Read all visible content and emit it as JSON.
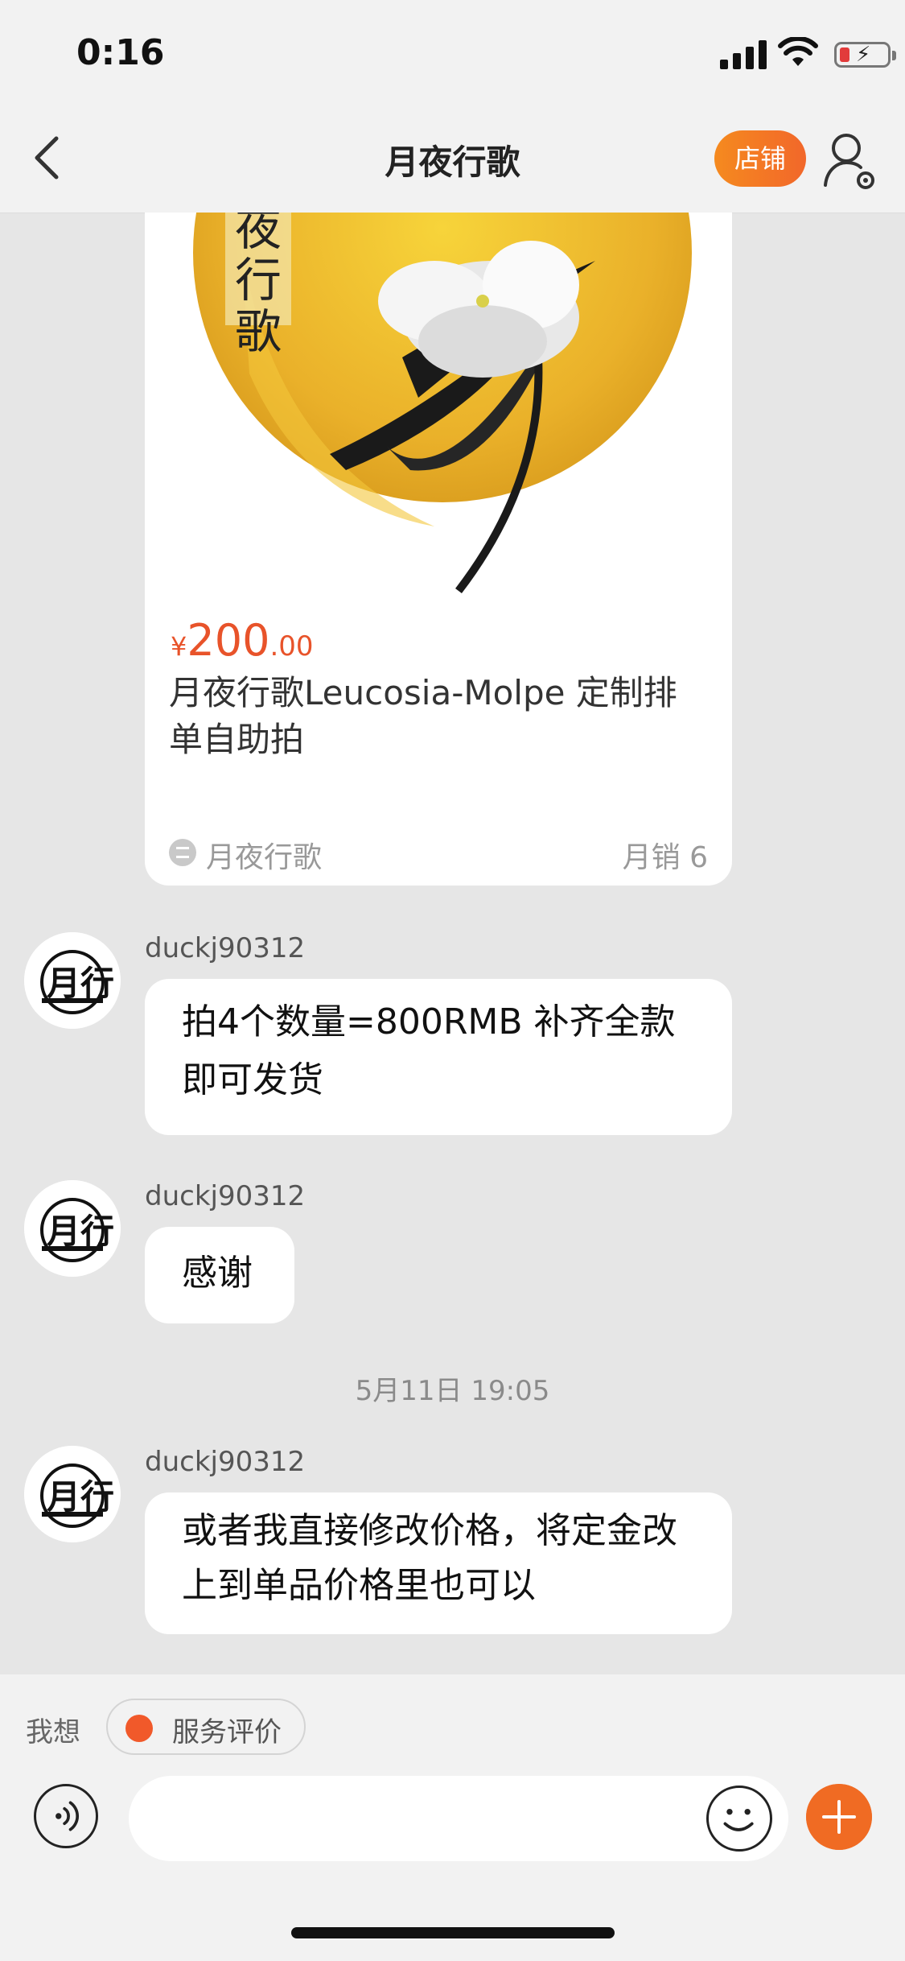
{
  "status_bar": {
    "time": "0:16"
  },
  "nav": {
    "title": "月夜行歌",
    "shop_label": "店铺"
  },
  "product": {
    "currency": "¥",
    "price_int": "200",
    "price_dec": ".00",
    "title": "月夜行歌Leucosia-Molpe 定制排单自助拍",
    "image_text": "夜行歌",
    "shop_name": "月夜行歌",
    "monthly_sales": "月销 6"
  },
  "messages": [
    {
      "sender": "duckj90312",
      "text": "拍4个数量=800RMB 补齐全款 即可发货"
    },
    {
      "sender": "duckj90312",
      "text": "感谢"
    },
    {
      "sender": "duckj90312",
      "text": "或者我直接修改价格，将定金改上到单品价格里也可以"
    }
  ],
  "avatar_text": "月行",
  "timestamp": "5月11日 19:05",
  "quick_actions": {
    "want_label": "我想",
    "service_review": "服务评价"
  },
  "input": {
    "value": "",
    "placeholder": ""
  },
  "colors": {
    "accent": "#f06b23",
    "price": "#e8532a",
    "background": "#e6e6e6"
  }
}
